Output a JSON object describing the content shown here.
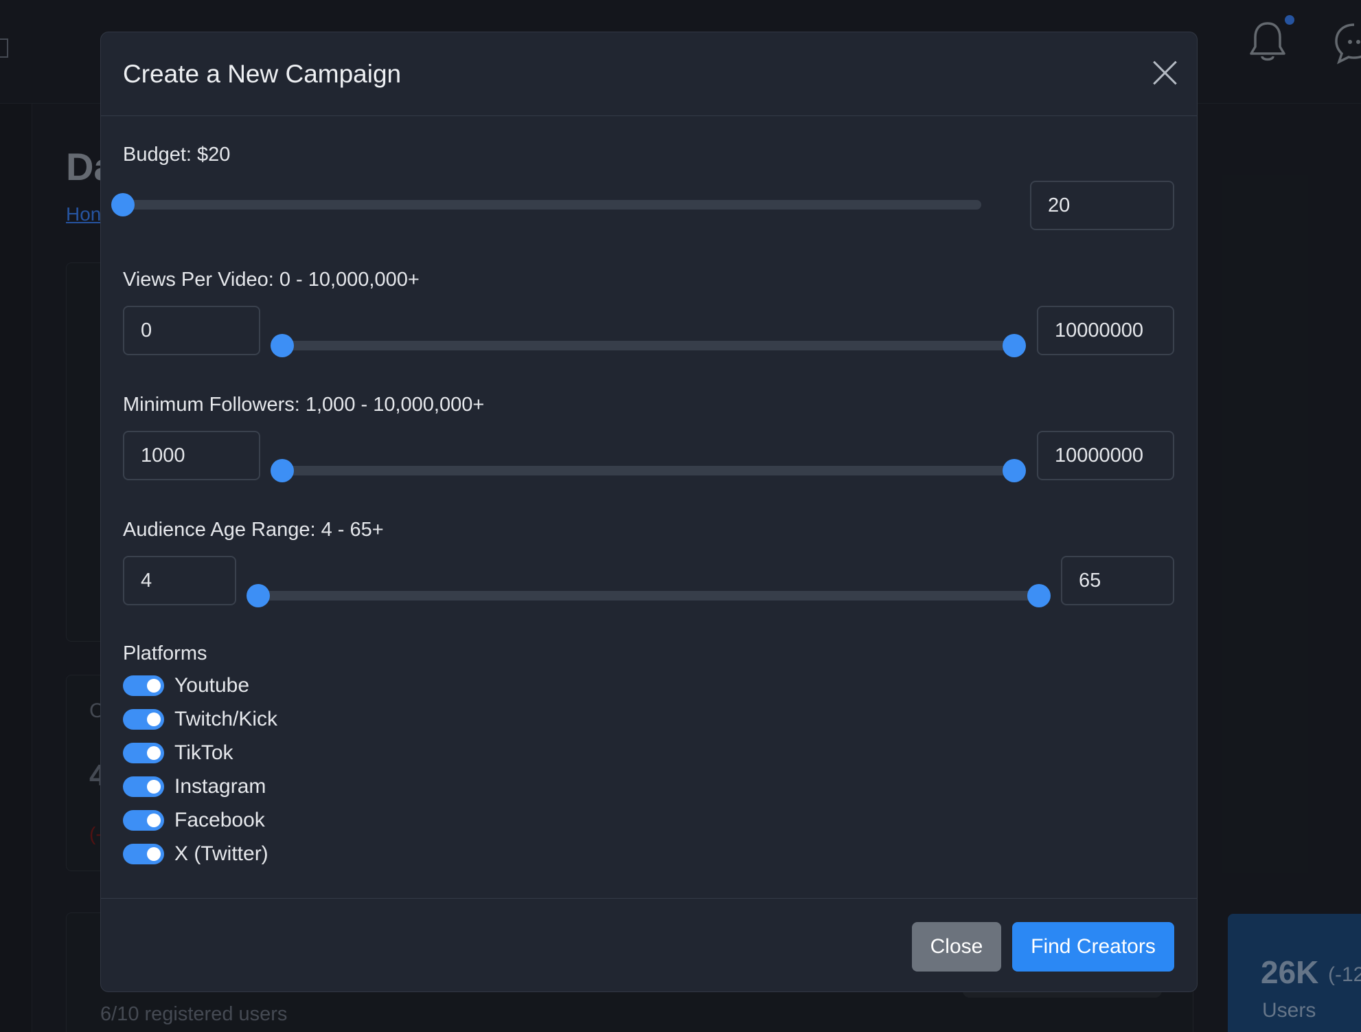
{
  "background": {
    "page_title": "Da",
    "breadcrumb_link": "Hon",
    "card_fragment_a": "C",
    "card_fragment_b": "4",
    "card_fragment_c": "(-",
    "registered_users": "6/10 registered users",
    "stat": {
      "value": "26K",
      "delta": "(-12",
      "label": "Users"
    }
  },
  "modal": {
    "title": "Create a New Campaign",
    "budget": {
      "label": "Budget: $20",
      "value": "20",
      "position": 0.0
    },
    "views": {
      "label": "Views Per Video: 0 - 10,000,000+",
      "min": "0",
      "max": "10000000",
      "min_position": 0.0,
      "max_position": 1.0
    },
    "followers": {
      "label": "Minimum Followers: 1,000 - 10,000,000+",
      "min": "1000",
      "max": "10000000",
      "min_position": 0.0,
      "max_position": 1.0
    },
    "age": {
      "label": "Audience Age Range: 4 - 65+",
      "min": "4",
      "max": "65",
      "min_position": 0.0,
      "max_position": 1.0
    },
    "platforms_label": "Platforms",
    "platforms": [
      {
        "label": "Youtube",
        "enabled": true
      },
      {
        "label": "Twitch/Kick",
        "enabled": true
      },
      {
        "label": "TikTok",
        "enabled": true
      },
      {
        "label": "Instagram",
        "enabled": true
      },
      {
        "label": "Facebook",
        "enabled": true
      },
      {
        "label": "X (Twitter)",
        "enabled": true
      }
    ],
    "footer": {
      "close_label": "Close",
      "submit_label": "Find Creators"
    }
  },
  "colors": {
    "accent": "#3d8ff5",
    "modal_bg": "#212631",
    "page_bg": "#1f232b"
  },
  "icons": {
    "notifications": "bell-icon",
    "messages": "chat-icon",
    "close": "close-icon",
    "menu": "menu-icon"
  }
}
